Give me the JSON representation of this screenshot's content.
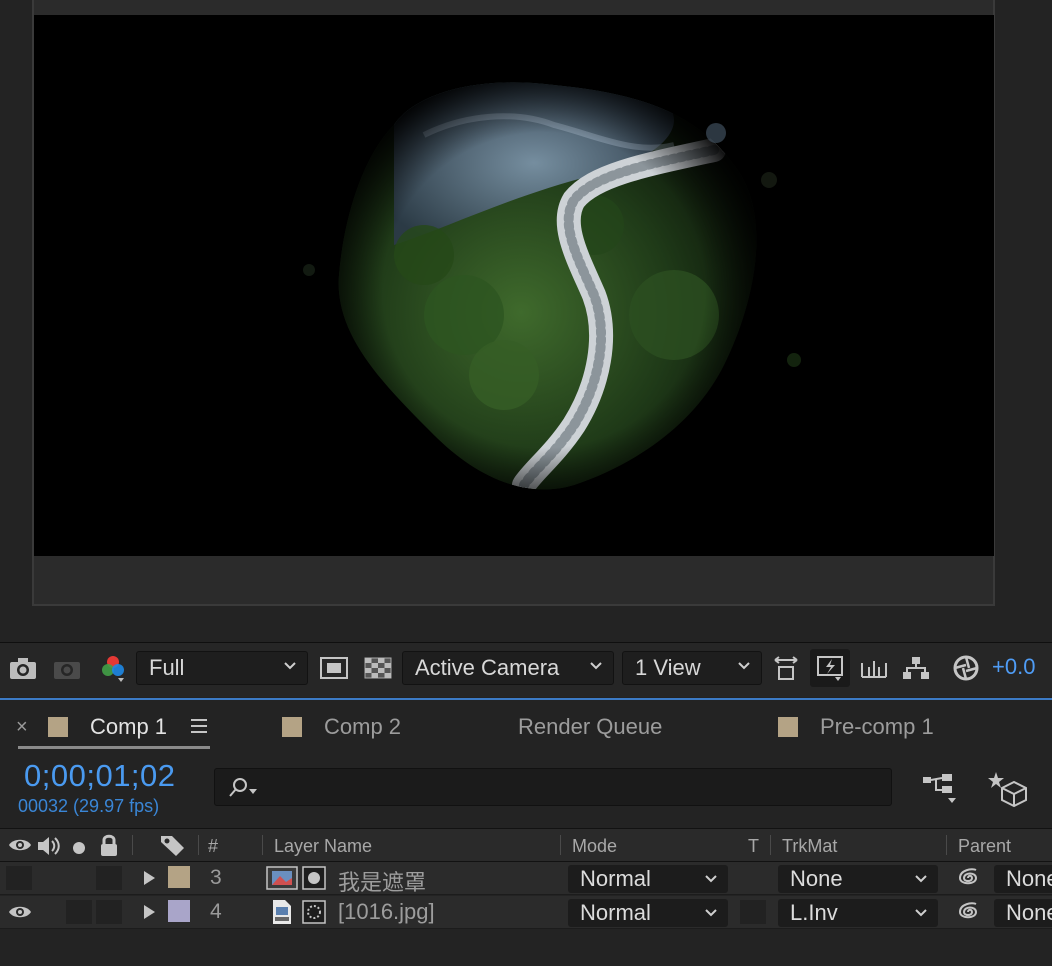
{
  "toolbar": {
    "resolution": "Full",
    "camera": "Active Camera",
    "views": "1 View",
    "exposure": "+0.0"
  },
  "tabs": [
    {
      "label": "Comp 1",
      "active": true
    },
    {
      "label": "Comp 2",
      "active": false
    },
    {
      "label": "Render Queue",
      "active": false
    },
    {
      "label": "Pre-comp 1",
      "active": false
    }
  ],
  "timecode": "0;00;01;02",
  "frame_info": "00032 (29.97 fps)",
  "search": {
    "placeholder": ""
  },
  "columns": {
    "number": "#",
    "layer_name": "Layer Name",
    "mode": "Mode",
    "t": "T",
    "trkmat": "TrkMat",
    "parent": "Parent"
  },
  "layers": [
    {
      "number": "3",
      "name": "我是遮罩",
      "mode": "Normal",
      "trkmat": "None",
      "parent": "None",
      "label_color": "#b4a385",
      "visible": false
    },
    {
      "number": "4",
      "name": "[1016.jpg]",
      "mode": "Normal",
      "trkmat": "L.Inv",
      "parent": "None",
      "label_color": "#a9a5c9",
      "visible": true
    }
  ],
  "colors": {
    "accent": "#4a9af0",
    "panel": "#232323"
  }
}
